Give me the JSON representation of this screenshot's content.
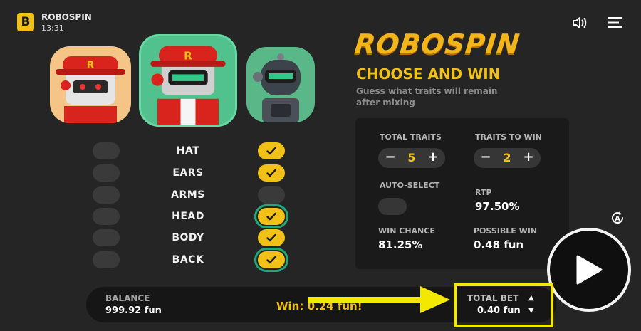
{
  "app": {
    "logo_letter": "B",
    "name": "ROBOSPIN",
    "time": "13:31"
  },
  "game": {
    "brand": "ROBOSPIN",
    "headline": "CHOOSE AND WIN",
    "subtitle_line1": "Guess what traits will remain",
    "subtitle_line2": "after mixing"
  },
  "traits": [
    {
      "name": "HAT",
      "selected": true
    },
    {
      "name": "EARS",
      "selected": true
    },
    {
      "name": "ARMS",
      "selected": false
    },
    {
      "name": "HEAD",
      "selected": true
    },
    {
      "name": "BODY",
      "selected": true
    },
    {
      "name": "BACK",
      "selected": true
    }
  ],
  "settings": {
    "total_traits_label": "TOTAL TRAITS",
    "total_traits_value": "5",
    "traits_to_win_label": "TRAITS TO WIN",
    "traits_to_win_value": "2",
    "minus": "−",
    "plus": "+",
    "auto_select_label": "AUTO-SELECT",
    "rtp_label": "RTP",
    "rtp_value": "97.50%",
    "win_chance_label": "WIN CHANCE",
    "win_chance_value": "81.25%",
    "possible_win_label": "POSSIBLE WIN",
    "possible_win_value": "0.48 fun"
  },
  "footer": {
    "balance_label": "BALANCE",
    "balance_value": "999.92 fun",
    "win_text": "Win: 0.24 fun!",
    "total_bet_label": "TOTAL BET",
    "total_bet_value": "0.40 fun",
    "up": "▲",
    "down": "▼"
  },
  "colors": {
    "accent": "#f2c118",
    "annotation": "#f3e800",
    "ring": "#1fa97a",
    "background": "#252525"
  },
  "icons": [
    "sound-icon",
    "menu-icon",
    "checkmark-icon",
    "autoplay-icon",
    "play-icon"
  ]
}
